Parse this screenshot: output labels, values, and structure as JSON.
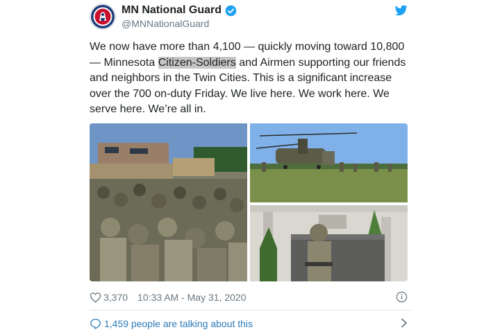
{
  "account": {
    "name": "MN National Guard",
    "handle": "@MNNationalGuard"
  },
  "tweet": {
    "text_before": "We now have more than 4,100 — quickly moving toward 10,800 — Minnesota ",
    "text_highlight": "Citizen-Soldiers",
    "text_after": " and Airmen supporting our friends and neighbors in the Twin Cities. This is a significant increase over the 700 on-duty Friday. We live here. We work here. We serve here. We’re all in."
  },
  "stats": {
    "likes": "3,370",
    "timestamp": "10:33 AM - May 31, 2020"
  },
  "conversation": {
    "label": "1,459 people are talking about this"
  },
  "icons": {
    "verified": "verified-badge-icon",
    "bird": "twitter-bird-icon",
    "like": "heart-icon",
    "info": "info-icon",
    "reply": "speech-bubble-icon",
    "chevron": "chevron-right-icon"
  },
  "colors": {
    "brand_blue": "#1da1f2",
    "link_blue": "#2b7bb9",
    "muted_text": "#697882",
    "highlight": "#c6c6c6"
  }
}
